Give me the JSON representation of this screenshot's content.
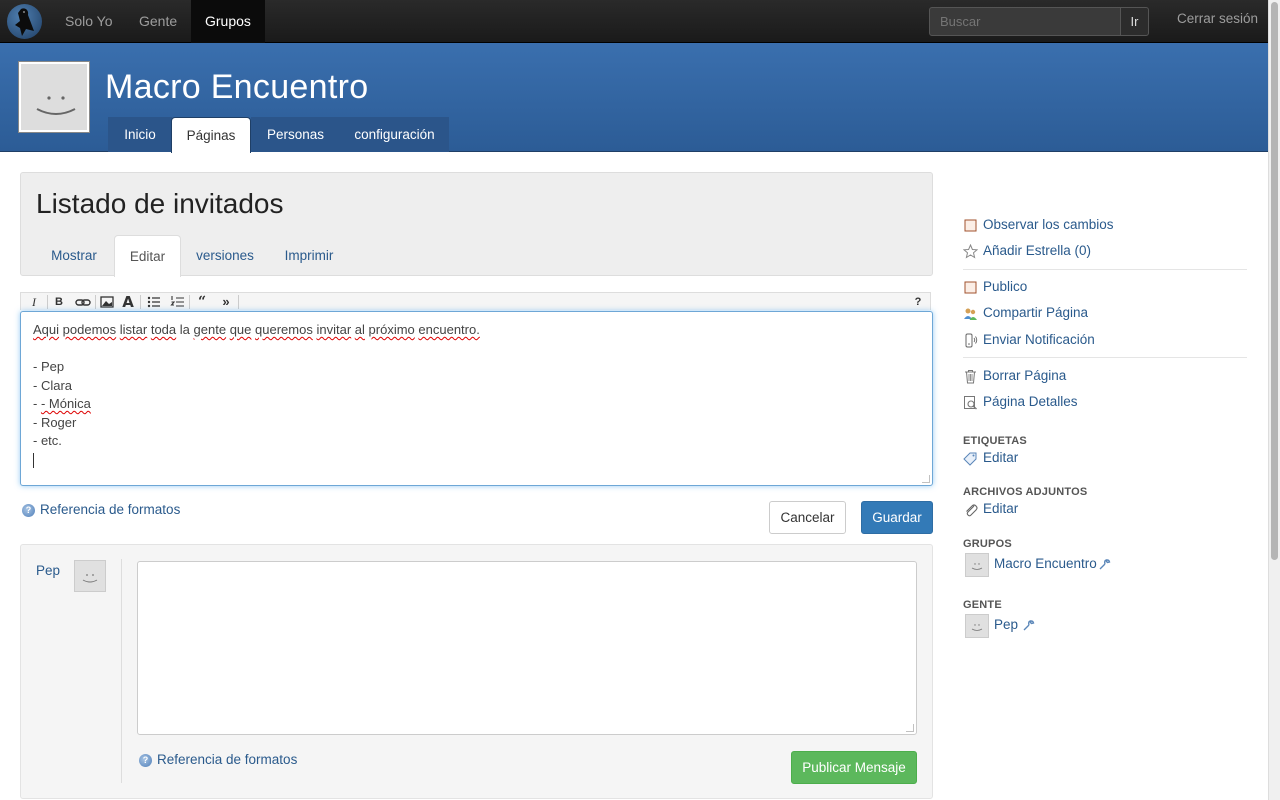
{
  "navbar": {
    "items": [
      "Solo Yo",
      "Gente",
      "Grupos"
    ],
    "search_placeholder": "Buscar",
    "search_button": "Ir",
    "logout": "Cerrar sesión"
  },
  "group": {
    "title": "Macro Encuentro",
    "tabs": [
      "Inicio",
      "Páginas",
      "Personas",
      "configuración"
    ]
  },
  "page": {
    "title": "Listado de invitados",
    "tabs": [
      "Mostrar",
      "Editar",
      "versiones",
      "Imprimir"
    ]
  },
  "editor": {
    "toolbar": [
      "I",
      "B",
      "link",
      "image",
      "A",
      "ul",
      "ol",
      "quote",
      "more",
      "?"
    ],
    "intro": [
      "Aqui",
      "podemos",
      "listar",
      "toda",
      "la",
      "gente",
      "que",
      "queremos",
      "invitar",
      "al",
      "próximo",
      "encuentro."
    ],
    "list": [
      "- Pep",
      "- Clara",
      "- Mónica",
      "- Roger",
      "- etc."
    ]
  },
  "form": {
    "format_ref": "Referencia de formatos",
    "cancel": "Cancelar",
    "save": "Guardar"
  },
  "comment": {
    "author": "Pep",
    "format_ref": "Referencia de formatos",
    "publish": "Publicar Mensaje"
  },
  "sidebar": {
    "watch": "Observar los cambios",
    "star": "Añadir Estrella (0)",
    "public": "Publico",
    "share": "Compartir Página",
    "notify": "Enviar Notificación",
    "delete": "Borrar Página",
    "details": "Página Detalles",
    "tags_heading": "ETIQUETAS",
    "tags_edit": "Editar",
    "attachments_heading": "ARCHIVOS ADJUNTOS",
    "attachments_edit": "Editar",
    "groups_heading": "GRUPOS",
    "group_name": "Macro Encuentro",
    "people_heading": "GENTE",
    "person_name": "Pep"
  }
}
